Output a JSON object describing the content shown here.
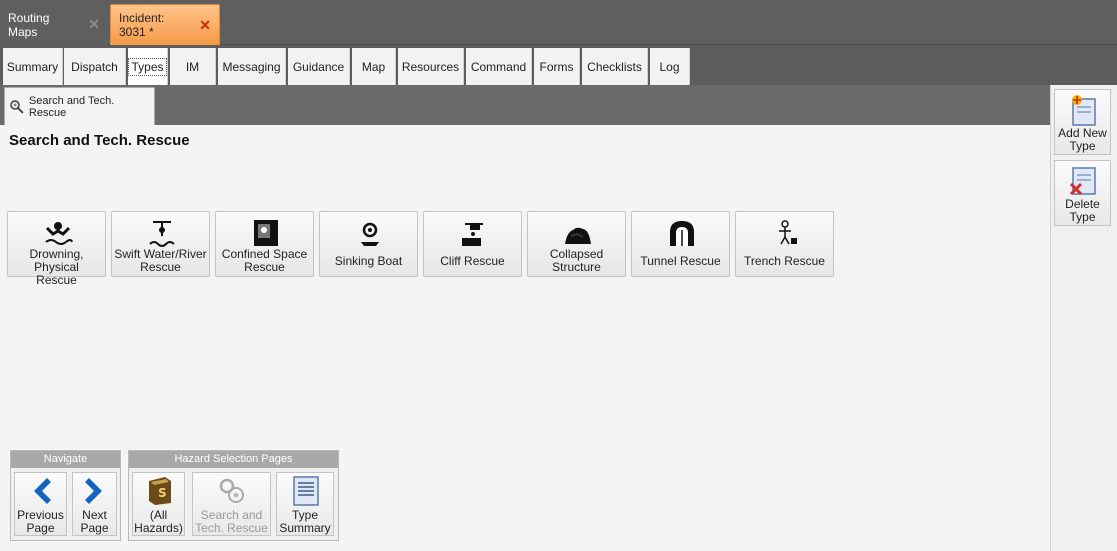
{
  "doc_tabs": [
    {
      "label": "Routing Maps",
      "close": "✕"
    },
    {
      "label": "Incident: 3031 *",
      "close": "✕"
    }
  ],
  "nav_tabs": [
    "Summary",
    "Dispatch",
    "Types",
    "IM",
    "Messaging",
    "Guidance",
    "Map",
    "Resources",
    "Command",
    "Forms",
    "Checklists",
    "Log"
  ],
  "selected_nav": "Types",
  "sub_tab": {
    "label": "Search and Tech. Rescue"
  },
  "page_title": "Search and Tech. Rescue",
  "types": [
    {
      "line1": "Drowning, Physical",
      "line2": "Rescue",
      "icon": "drowning-icon"
    },
    {
      "line1": "Swift Water/River",
      "line2": "Rescue",
      "icon": "swift-water-icon"
    },
    {
      "line1": "Confined Space",
      "line2": "Rescue",
      "icon": "confined-space-icon"
    },
    {
      "line1": "Sinking Boat",
      "line2": "",
      "icon": "sinking-boat-icon"
    },
    {
      "line1": "Cliff Rescue",
      "line2": "",
      "icon": "cliff-rescue-icon"
    },
    {
      "line1": "Collapsed",
      "line2": "Structure",
      "icon": "collapsed-structure-icon"
    },
    {
      "line1": "Tunnel Rescue",
      "line2": "",
      "icon": "tunnel-icon"
    },
    {
      "line1": "Trench Rescue",
      "line2": "",
      "icon": "trench-icon"
    }
  ],
  "navigate": {
    "title": "Navigate",
    "previous": {
      "line1": "Previous",
      "line2": "Page"
    },
    "next": {
      "line1": "Next",
      "line2": "Page"
    }
  },
  "hazard_pages": {
    "title": "Hazard Selection Pages",
    "all": {
      "line1": "(All",
      "line2": "Hazards)"
    },
    "search": {
      "line1": "Search and",
      "line2": "Tech. Rescue"
    },
    "summary": {
      "line1": "Type",
      "line2": "Summary"
    }
  },
  "right_panel": {
    "add": {
      "line1": "Add New",
      "line2": "Type"
    },
    "delete": {
      "line1": "Delete",
      "line2": "Type"
    }
  }
}
